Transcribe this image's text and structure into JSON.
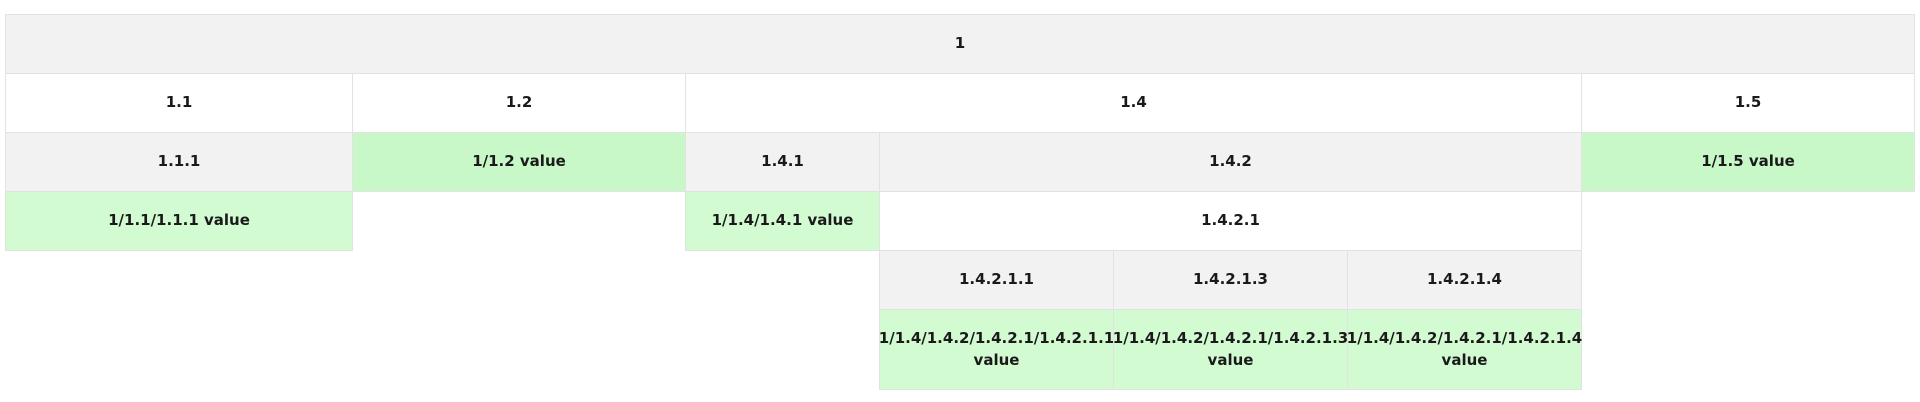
{
  "tree": {
    "root": "1",
    "level2": {
      "c1_1": "1.1",
      "c1_2": "1.2",
      "c1_4": "1.4",
      "c1_5": "1.5"
    },
    "level3": {
      "c1_1_1": "1.1.1",
      "v1_2": "1/1.2 value",
      "c1_4_1": "1.4.1",
      "c1_4_2": "1.4.2",
      "v1_5": "1/1.5 value"
    },
    "level4": {
      "v1_1_1": "1/1.1/1.1.1 value",
      "v1_4_1": "1/1.4/1.4.1 value",
      "c1_4_2_1": "1.4.2.1"
    },
    "level5": {
      "c1_4_2_1_1": "1.4.2.1.1",
      "c1_4_2_1_3": "1.4.2.1.3",
      "c1_4_2_1_4": "1.4.2.1.4"
    },
    "level6": {
      "v1_4_2_1_1": "1/1.4/1.4.2/1.4.2.1/1.4.2.1.1 value",
      "v1_4_2_1_3": "1/1.4/1.4.2/1.4.2.1/1.4.2.1.3 value",
      "v1_4_2_1_4": "1/1.4/1.4.2/1.4.2.1/1.4.2.1.4 value"
    }
  }
}
